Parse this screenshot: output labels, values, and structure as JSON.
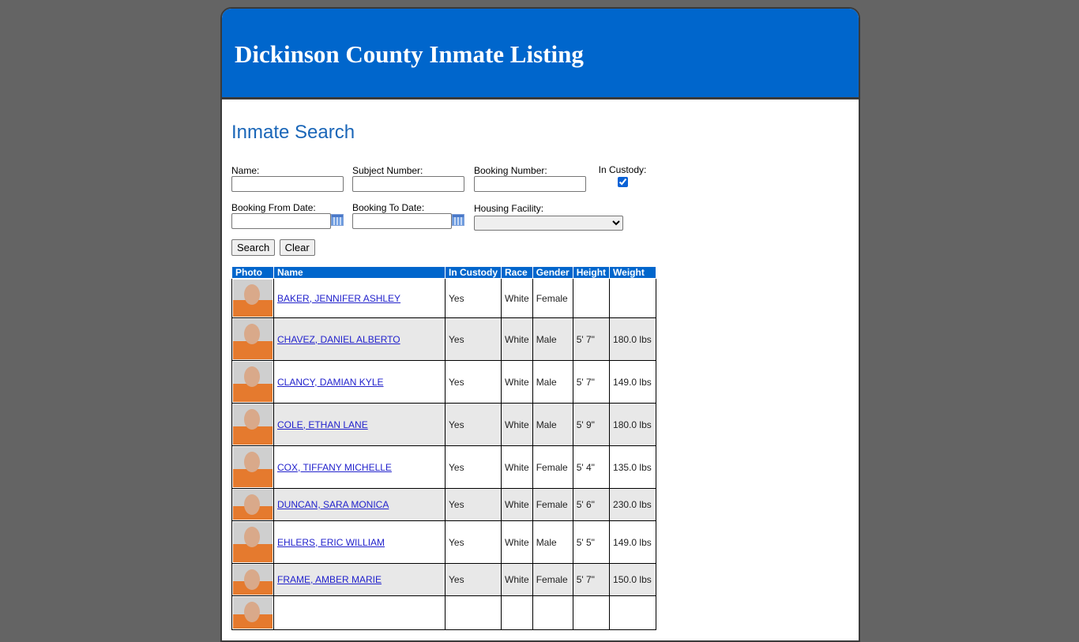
{
  "header": {
    "title": "Dickinson County Inmate Listing"
  },
  "search": {
    "heading": "Inmate Search",
    "name_label": "Name:",
    "name_value": "",
    "subject_label": "Subject Number:",
    "subject_value": "",
    "booking_label": "Booking Number:",
    "booking_value": "",
    "custody_label": "In Custody:",
    "custody_checked": true,
    "from_label": "Booking From Date:",
    "from_value": "",
    "to_label": "Booking To Date:",
    "to_value": "",
    "facility_label": "Housing Facility:",
    "facility_value": "",
    "search_btn": "Search",
    "clear_btn": "Clear"
  },
  "table": {
    "columns": [
      "Photo",
      "Name",
      "In Custody",
      "Race",
      "Gender",
      "Height",
      "Weight"
    ],
    "rows": [
      {
        "name": "BAKER, JENNIFER ASHLEY",
        "custody": "Yes",
        "race": "White",
        "gender": "Female",
        "height": "",
        "weight": ""
      },
      {
        "name": "CHAVEZ, DANIEL ALBERTO",
        "custody": "Yes",
        "race": "White",
        "gender": "Male",
        "height": "5' 7\"",
        "weight": "180.0 lbs"
      },
      {
        "name": "CLANCY, DAMIAN KYLE",
        "custody": "Yes",
        "race": "White",
        "gender": "Male",
        "height": "5' 7\"",
        "weight": "149.0 lbs"
      },
      {
        "name": "COLE, ETHAN LANE",
        "custody": "Yes",
        "race": "White",
        "gender": "Male",
        "height": "5' 9\"",
        "weight": "180.0 lbs"
      },
      {
        "name": "COX, TIFFANY MICHELLE",
        "custody": "Yes",
        "race": "White",
        "gender": "Female",
        "height": "5' 4\"",
        "weight": "135.0 lbs"
      },
      {
        "name": "DUNCAN, SARA MONICA",
        "custody": "Yes",
        "race": "White",
        "gender": "Female",
        "height": "5' 6\"",
        "weight": "230.0 lbs"
      },
      {
        "name": "EHLERS, ERIC WILLIAM",
        "custody": "Yes",
        "race": "White",
        "gender": "Male",
        "height": "5' 5\"",
        "weight": "149.0 lbs"
      },
      {
        "name": "FRAME, AMBER MARIE",
        "custody": "Yes",
        "race": "White",
        "gender": "Female",
        "height": "5' 7\"",
        "weight": "150.0 lbs"
      },
      {
        "name": "",
        "custody": "",
        "race": "",
        "gender": "",
        "height": "",
        "weight": ""
      }
    ]
  }
}
